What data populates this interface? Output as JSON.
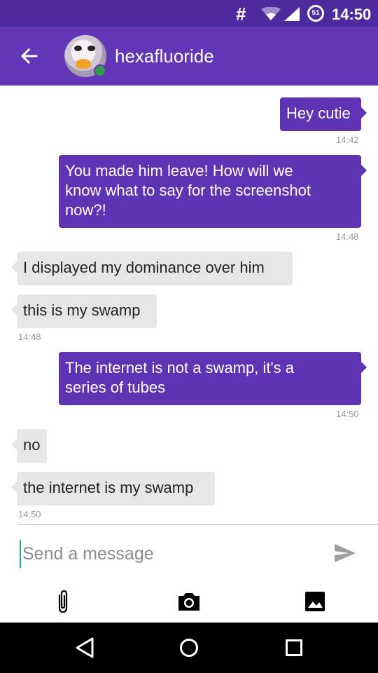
{
  "status_bar": {
    "hash": "#",
    "battery": "51",
    "time": "14:50"
  },
  "header": {
    "contact_name": "hexafluoride"
  },
  "messages": [
    {
      "text": "Hey cutie",
      "time": "14:42"
    },
    {
      "text": "You made him leave! How will we\nknow what to say for the screenshot\nnow?!",
      "time": "14:48"
    },
    {
      "text": "I displayed my dominance over him"
    },
    {
      "text": "this is my swamp",
      "time": "14:48"
    },
    {
      "text": "The internet is not a swamp, it's a\nseries of tubes",
      "time": "14:50"
    },
    {
      "text": "no"
    },
    {
      "text": "the internet is my swamp",
      "time": "14:50"
    }
  ],
  "compose": {
    "placeholder": "Send a message",
    "value": ""
  },
  "colors": {
    "status_bar": "#4e2a9e",
    "app_bar": "#6236b6",
    "outgoing": "#5f34b4",
    "incoming": "#e6e6e6",
    "online": "#2e9d4f"
  },
  "icons": [
    "back-arrow-icon",
    "wifi-icon",
    "signal-icon",
    "battery-icon",
    "send-icon",
    "attachment-icon",
    "camera-icon",
    "image-icon",
    "nav-back-icon",
    "nav-home-icon",
    "nav-recents-icon"
  ]
}
